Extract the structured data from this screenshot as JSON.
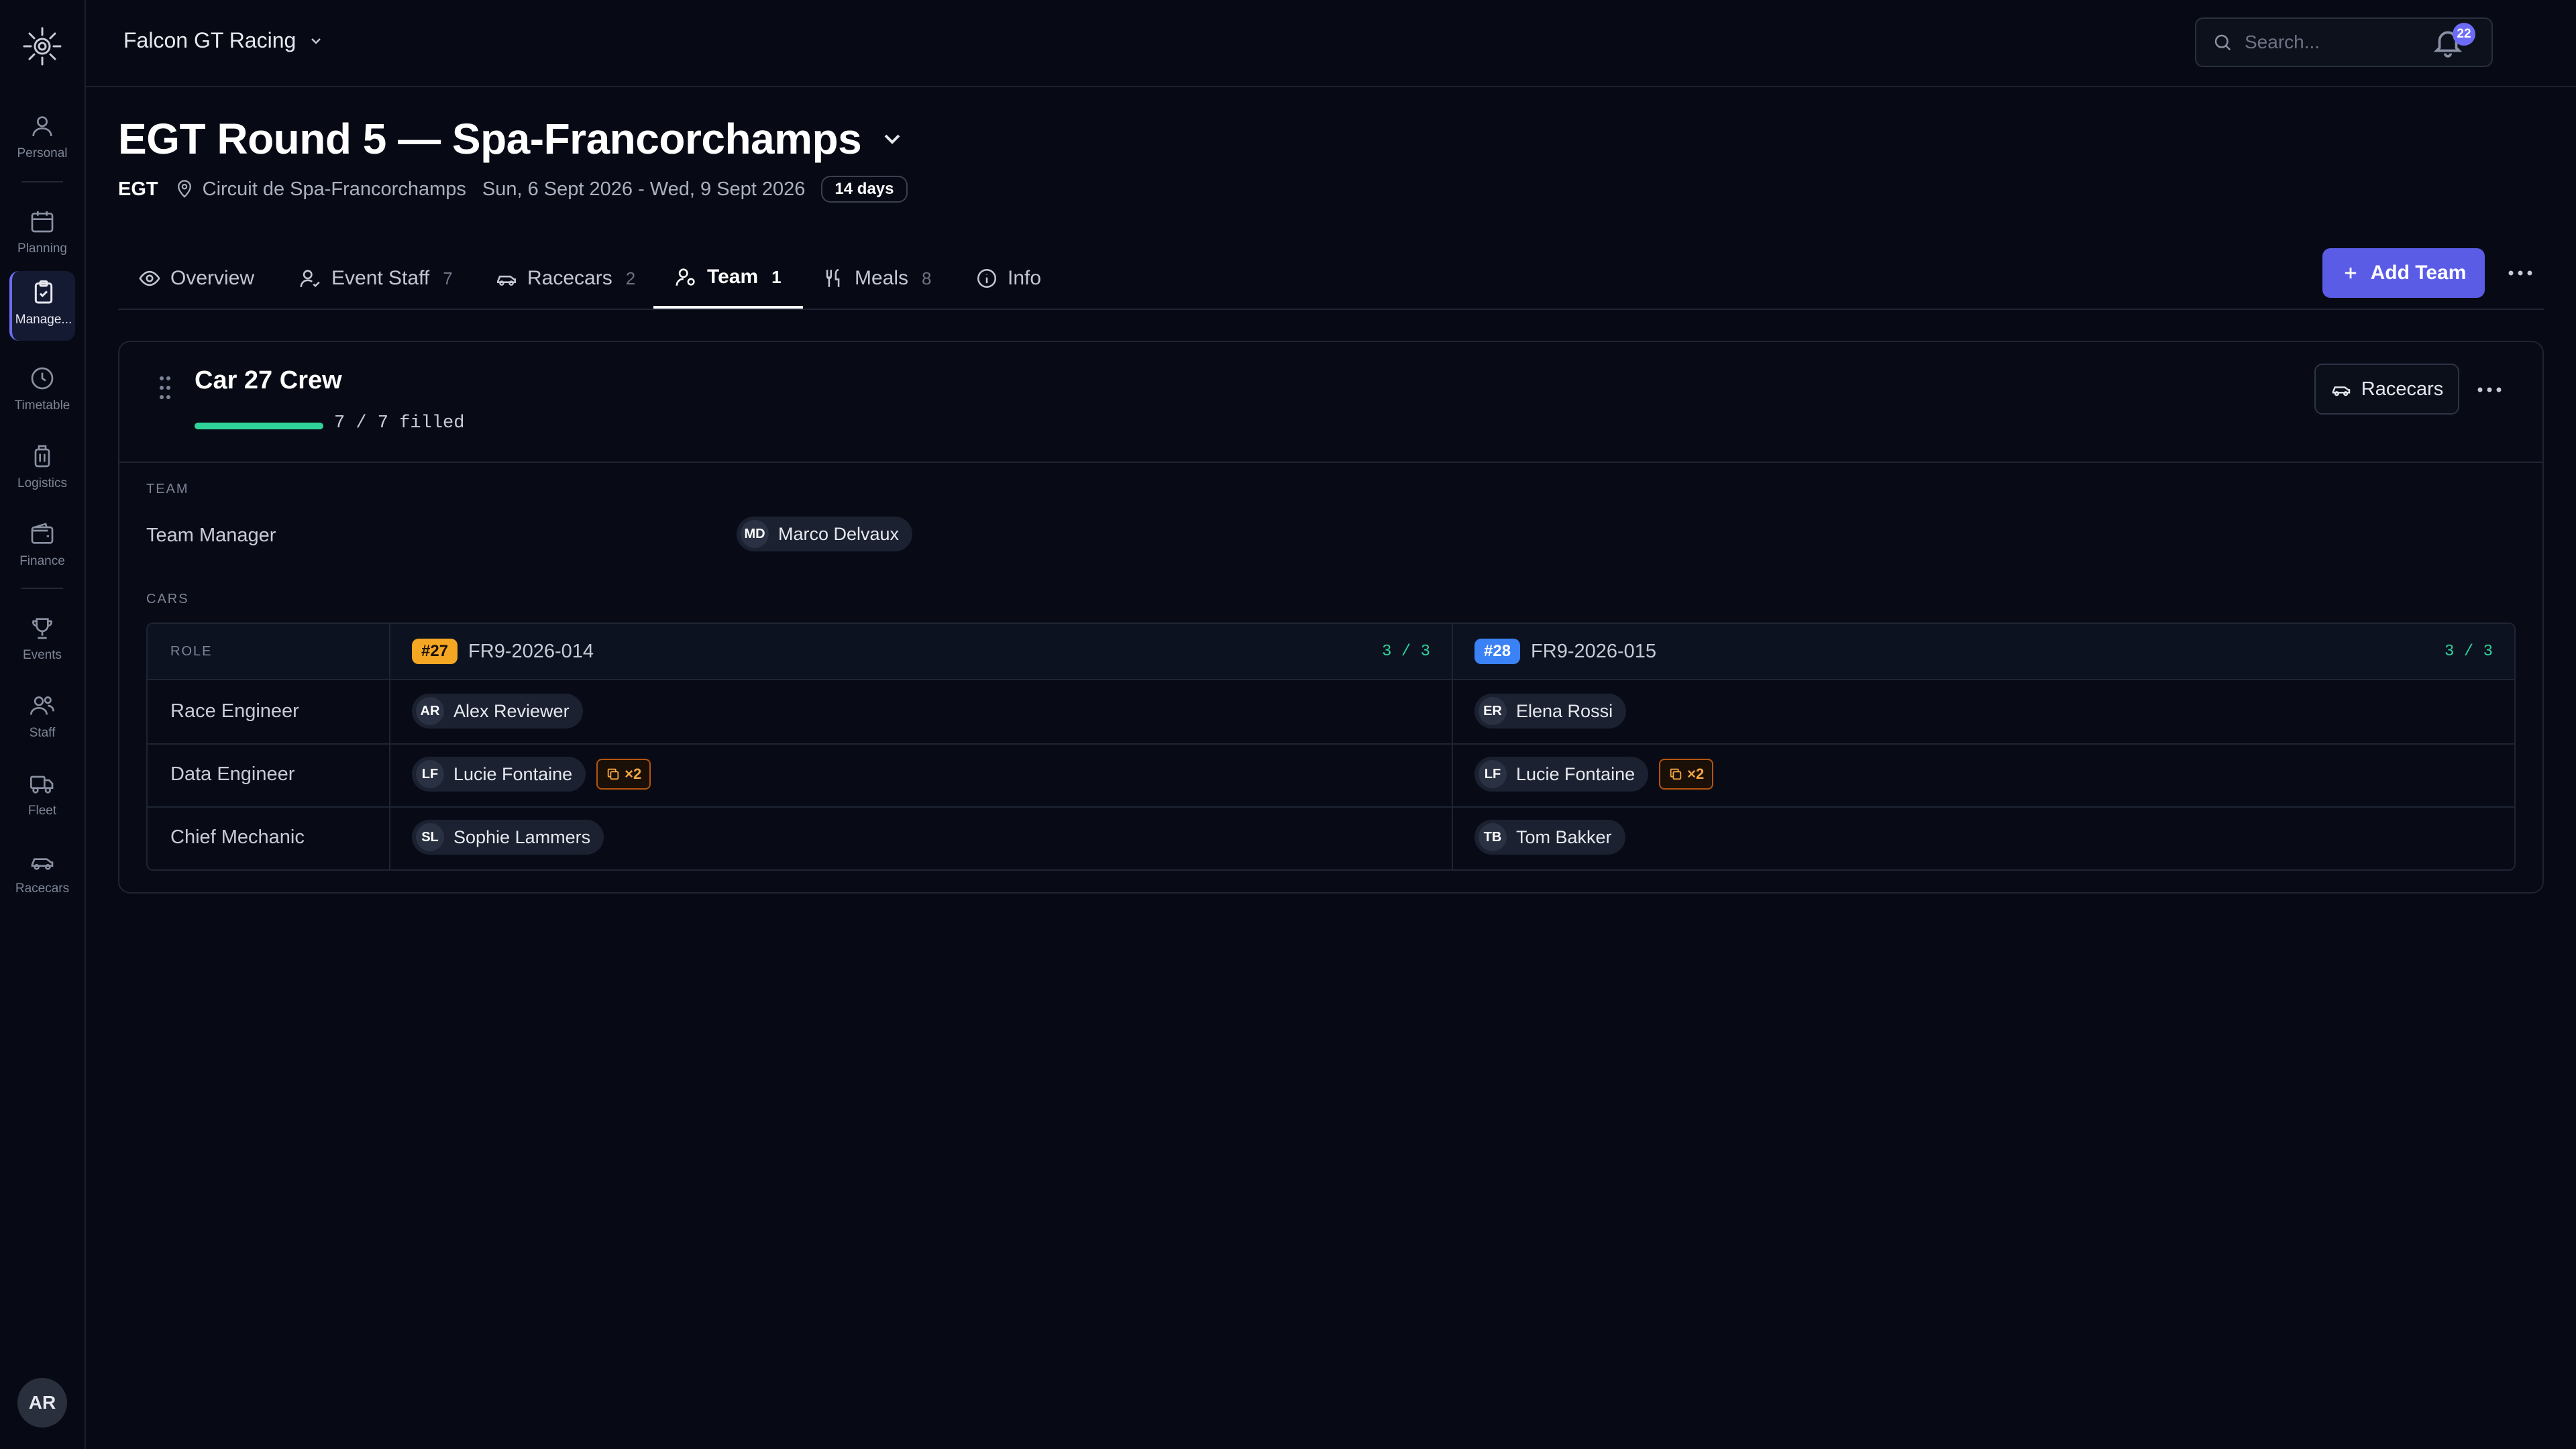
{
  "org": {
    "name": "Falcon GT Racing"
  },
  "search": {
    "placeholder": "Search..."
  },
  "notifications": {
    "count": "22"
  },
  "sidebar": {
    "items": [
      {
        "label": "Personal",
        "icon": "person-icon"
      },
      {
        "label": "Planning",
        "icon": "calendar-icon"
      },
      {
        "label": "Manage...",
        "icon": "clipboard-icon"
      },
      {
        "label": "Timetable",
        "icon": "clock-icon"
      },
      {
        "label": "Logistics",
        "icon": "luggage-icon"
      },
      {
        "label": "Finance",
        "icon": "wallet-icon"
      },
      {
        "label": "Events",
        "icon": "trophy-icon"
      },
      {
        "label": "Staff",
        "icon": "users-icon"
      },
      {
        "label": "Fleet",
        "icon": "truck-icon"
      },
      {
        "label": "Racecars",
        "icon": "car-icon"
      }
    ],
    "user_initials": "AR"
  },
  "event": {
    "title": "EGT Round 5 — Spa-Francorchamps",
    "series": "EGT",
    "location": "Circuit de Spa-Francorchamps",
    "dates": "Sun, 6 Sept 2026 - Wed, 9 Sept 2026",
    "duration": "14 days"
  },
  "tabs": [
    {
      "label": "Overview",
      "count": ""
    },
    {
      "label": "Event Staff",
      "count": "7"
    },
    {
      "label": "Racecars",
      "count": "2"
    },
    {
      "label": "Team",
      "count": "1"
    },
    {
      "label": "Meals",
      "count": "8"
    },
    {
      "label": "Info",
      "count": ""
    }
  ],
  "actions": {
    "add_team": "Add Team"
  },
  "crew": {
    "title": "Car 27 Crew",
    "filled_text": "7 / 7 filled",
    "filled_fraction": 1.0,
    "racecars_button": "Racecars",
    "team_section_label": "TEAM",
    "cars_section_label": "CARS",
    "team_manager": {
      "role": "Team Manager",
      "initials": "MD",
      "name": "Marco Delvaux"
    },
    "table": {
      "role_header": "ROLE",
      "cars": [
        {
          "number": "#27",
          "id": "FR9-2026-014",
          "count": "3 / 3",
          "color": "#f5a623"
        },
        {
          "number": "#28",
          "id": "FR9-2026-015",
          "count": "3 / 3",
          "color": "#3b82f6"
        }
      ],
      "rows": [
        {
          "role": "Race Engineer",
          "cells": [
            {
              "initials": "AR",
              "name": "Alex Reviewer",
              "dup": ""
            },
            {
              "initials": "ER",
              "name": "Elena Rossi",
              "dup": ""
            }
          ]
        },
        {
          "role": "Data Engineer",
          "cells": [
            {
              "initials": "LF",
              "name": "Lucie Fontaine",
              "dup": "×2"
            },
            {
              "initials": "LF",
              "name": "Lucie Fontaine",
              "dup": "×2"
            }
          ]
        },
        {
          "role": "Chief Mechanic",
          "cells": [
            {
              "initials": "SL",
              "name": "Sophie Lammers",
              "dup": ""
            },
            {
              "initials": "TB",
              "name": "Tom Bakker",
              "dup": ""
            }
          ]
        }
      ]
    }
  },
  "colors": {
    "accent": "#5b5ce6",
    "success": "#2fd39a",
    "warning": "#f5a543",
    "background": "#070a14"
  }
}
